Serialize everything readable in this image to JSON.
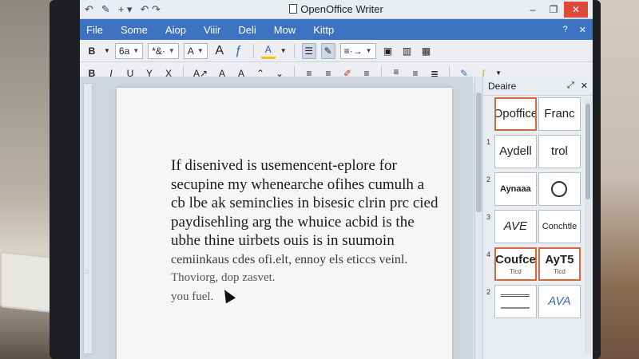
{
  "window": {
    "title": "OpenOffice Writer",
    "quick_access": [
      "↶",
      "✎",
      "+ ▾",
      "↶ ↷"
    ],
    "controls": [
      "–",
      "❐",
      "✕"
    ]
  },
  "menubar": {
    "items": [
      "File",
      "Some",
      "Aiop",
      "Viiir",
      "Deli",
      "Mow",
      "Kittp"
    ],
    "right": [
      "?",
      "✕"
    ]
  },
  "toolbar1": {
    "bold_label": "B",
    "font_size": "6a",
    "style_combo": "*&·",
    "font_color_combo": "A",
    "glyph_a": "A",
    "glyph_f": "ƒ",
    "highlight": "A",
    "list_combo": "≡·→"
  },
  "toolbar2": {
    "bold": "B",
    "italic": "I",
    "underline": "U",
    "y": "Y",
    "x": "X",
    "az": "A↗",
    "a1": "A",
    "a2": "A",
    "a3": "A"
  },
  "ruler": {
    "tab_marker": "1"
  },
  "document": {
    "lines": [
      "If disenived is usemencent-eplore for",
      "secupine my whenearche ofihes cumulh a",
      "cb lbe ak seminclies in bisesic clrin prc cied",
      "paydisehling arg the whuice acbid is the",
      "ubhe thine uirbets ouis is in suumoin",
      "cemiinkaus cdes ofi.elt, ennoy els eticcs veinl.",
      "Thoviorg, dop zasvet.",
      "you fuel."
    ]
  },
  "side_panel": {
    "title": "Deaire",
    "controls": [
      "⤢",
      "✕"
    ],
    "rows": [
      {
        "num": "",
        "cards": [
          {
            "big": "Opoffice",
            "small": "",
            "selected": true
          },
          {
            "big": "Franc",
            "small": ""
          }
        ]
      },
      {
        "num": "1",
        "cards": [
          {
            "big": "Aydell",
            "small": ""
          },
          {
            "big": "trol",
            "small": ""
          }
        ]
      },
      {
        "num": "2",
        "cards": [
          {
            "big": "Aynaaa",
            "small": ""
          },
          {
            "big": "",
            "small": "",
            "circle": true
          }
        ]
      },
      {
        "num": "3",
        "cards": [
          {
            "big": "AVE",
            "small": ""
          },
          {
            "big": "Conchtle",
            "small": ""
          }
        ]
      },
      {
        "num": "4",
        "cards": [
          {
            "big": "Coufce",
            "small": "Ticd",
            "selected": true
          },
          {
            "big": "AyT5",
            "small": "Ticd",
            "selected": true
          }
        ]
      },
      {
        "num": "2",
        "cards": [
          {
            "big": "",
            "small": "",
            "lines": true
          },
          {
            "big": "AVA",
            "small": ""
          }
        ]
      }
    ]
  }
}
